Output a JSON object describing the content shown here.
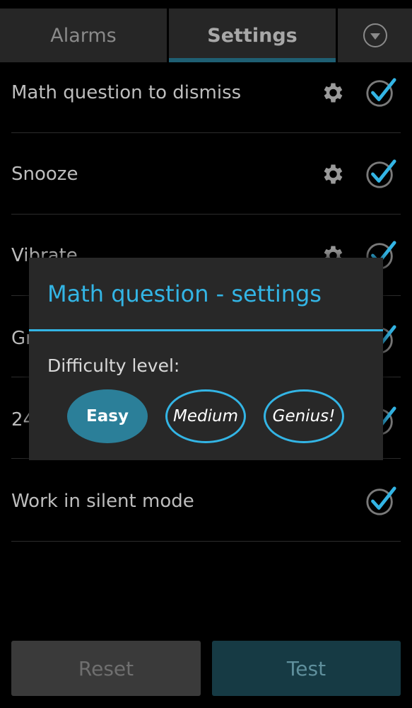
{
  "tabs": [
    {
      "label": "Alarms"
    },
    {
      "label": "Settings"
    }
  ],
  "settings": [
    {
      "label": "Math question to dismiss",
      "has_gear": true,
      "checked": true
    },
    {
      "label": "Snooze",
      "has_gear": true,
      "checked": true
    },
    {
      "label": "Vibrate",
      "has_gear": true,
      "checked": true
    },
    {
      "label": "Gr",
      "has_gear": false,
      "checked": true
    },
    {
      "label": "24",
      "has_gear": false,
      "checked": true
    },
    {
      "label": "Work in silent mode",
      "has_gear": false,
      "checked": true
    }
  ],
  "dialog": {
    "title": "Math question - settings",
    "difficulty_label": "Difficulty level:",
    "options": [
      {
        "label": "Easy",
        "selected": true
      },
      {
        "label": "Medium",
        "selected": false
      },
      {
        "label": "Genius!",
        "selected": false
      }
    ]
  },
  "buttons": {
    "reset": "Reset",
    "test": "Test"
  },
  "icons": {
    "tab_menu": "chevron-down-circle-icon",
    "settings": "gear-icon",
    "checkbox": "checkmark-icon"
  },
  "colors": {
    "accent": "#33b5e5",
    "selected_option": "#2b7f99",
    "background": "#000000",
    "dialog_bg": "#282828"
  }
}
